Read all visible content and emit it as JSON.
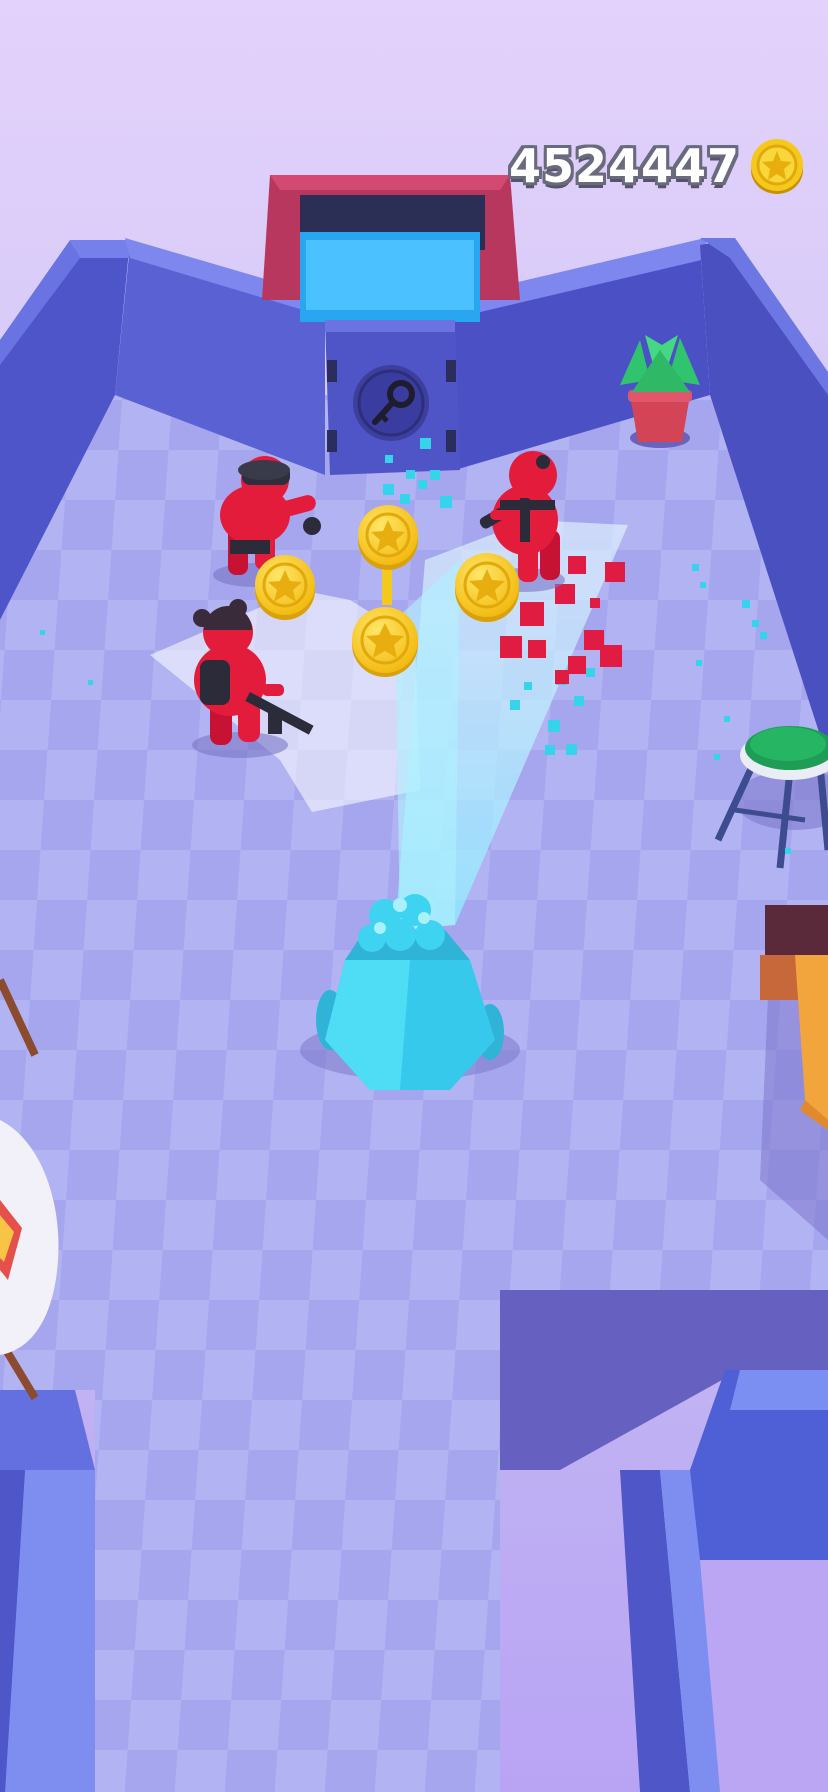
{
  "hud": {
    "coin_count": "4524447",
    "coin_icon": "coin-icon"
  },
  "colors": {
    "floor_light": "#b4b5f3",
    "floor_dark": "#a3a4ec",
    "wall_top": "#6f78e6",
    "wall_face": "#4a4fc4",
    "enemy": "#e31c3c",
    "coin": "#f5c91c",
    "cannon": "#3fd6f2",
    "beam": "#bff2ff"
  },
  "scene": {
    "enemies": [
      "guard-enemy-cap",
      "guard-enemy-buns",
      "guard-enemy-right"
    ],
    "coins_on_floor": 4,
    "props": [
      "vault-door-key-icon",
      "potted-plant",
      "green-stool",
      "cyan-cannon",
      "white-round-table",
      "orange-crate"
    ]
  }
}
